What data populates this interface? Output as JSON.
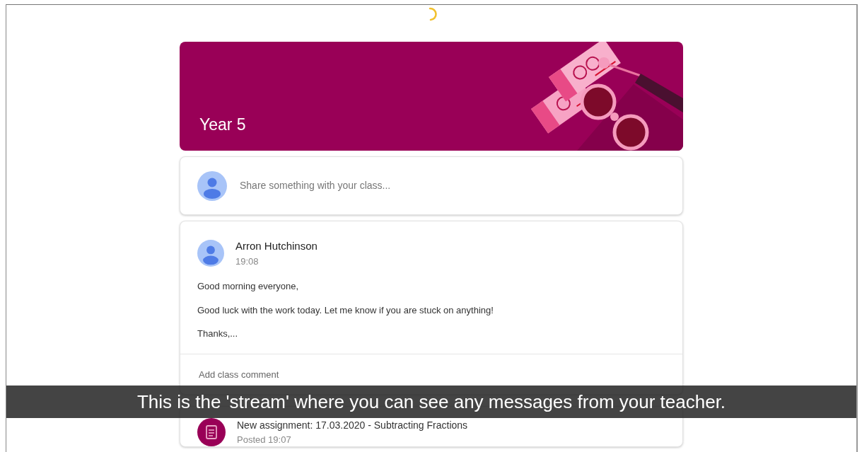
{
  "class_banner": {
    "title": "Year 5"
  },
  "share_box": {
    "placeholder": "Share something with your class..."
  },
  "posts": [
    {
      "kind": "announcement",
      "author": "Arron Hutchinson",
      "time": "19:08",
      "paragraphs": [
        "Good morning everyone,",
        "Good luck with the work today. Let me know if you are stuck on anything!",
        "Thanks,..."
      ],
      "comment_placeholder": "Add class comment"
    },
    {
      "kind": "assignment",
      "title": "New assignment: 17.03.2020 - Subtracting Fractions",
      "posted": "Posted 19:07"
    }
  ],
  "caption": "This is the 'stream' where you can see any messages from your teacher."
}
